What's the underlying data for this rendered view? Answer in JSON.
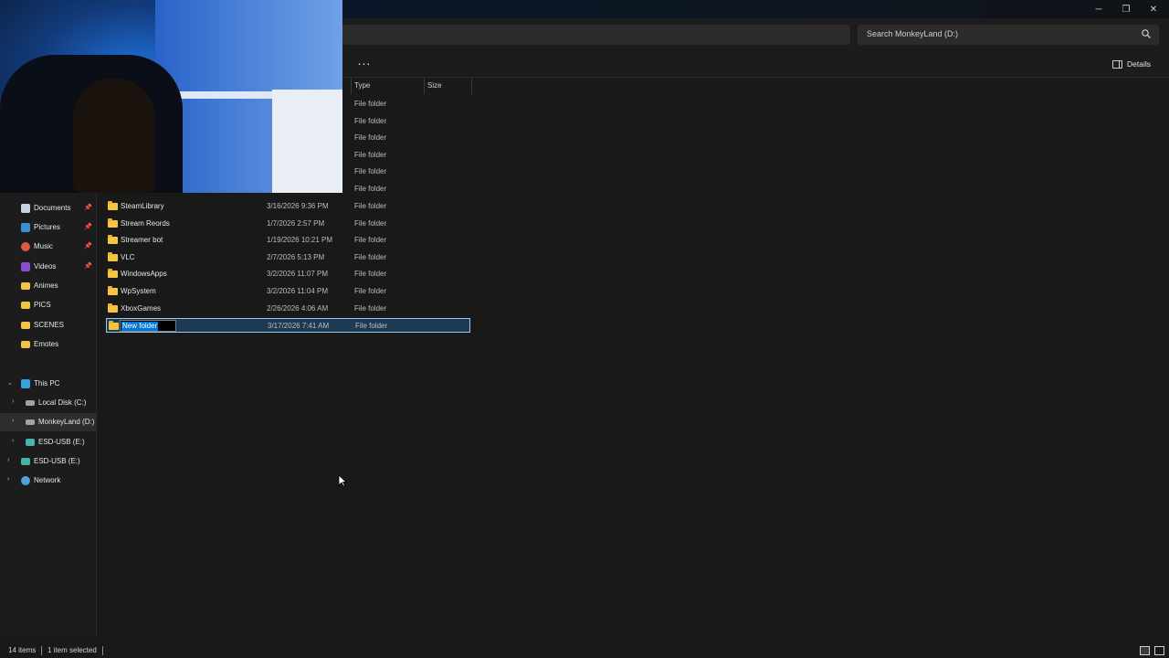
{
  "window": {
    "minimize_glyph": "─",
    "maximize_glyph": "❐",
    "close_glyph": "✕"
  },
  "search": {
    "placeholder": "Search MonkeyLand (D:)"
  },
  "toolbar": {
    "more_label": "...",
    "details_label": "Details"
  },
  "columns": {
    "type": "Type",
    "size": "Size"
  },
  "files": [
    {
      "name": "",
      "date": "",
      "type": "File folder"
    },
    {
      "name": "",
      "date": "",
      "type": "File folder"
    },
    {
      "name": "",
      "date": "",
      "type": "File folder"
    },
    {
      "name": "",
      "date": "",
      "type": "File folder"
    },
    {
      "name": "",
      "date": "",
      "type": "File folder"
    },
    {
      "name": "",
      "date": "",
      "type": "File folder"
    },
    {
      "name": "SteamLibrary",
      "date": "3/16/2026 9:36 PM",
      "type": "File folder"
    },
    {
      "name": "Stream Reords",
      "date": "1/7/2026 2:57 PM",
      "type": "File folder"
    },
    {
      "name": "Streamer bot",
      "date": "1/19/2026 10:21 PM",
      "type": "File folder"
    },
    {
      "name": "VLC",
      "date": "2/7/2026 5:13 PM",
      "type": "File folder"
    },
    {
      "name": "WindowsApps",
      "date": "3/2/2026 11:07 PM",
      "type": "File folder"
    },
    {
      "name": "WpSystem",
      "date": "3/2/2026 11:04 PM",
      "type": "File folder"
    },
    {
      "name": "XboxGames",
      "date": "2/26/2026 4:06 AM",
      "type": "File folder"
    },
    {
      "name": "New folder",
      "date": "3/17/2026 7:41 AM",
      "type": "File folder",
      "selected": true,
      "renaming": true
    }
  ],
  "sidebar": {
    "quick_access": [
      {
        "label": "Documents",
        "icon": "documents-icon",
        "pinned": true
      },
      {
        "label": "Pictures",
        "icon": "pictures-icon",
        "pinned": true
      },
      {
        "label": "Music",
        "icon": "music-icon",
        "pinned": true
      },
      {
        "label": "Videos",
        "icon": "videos-icon",
        "pinned": true
      },
      {
        "label": "Animes",
        "icon": "folder-icon"
      },
      {
        "label": "PICS",
        "icon": "folder-icon"
      },
      {
        "label": "SCENES",
        "icon": "folder-icon"
      },
      {
        "label": "Emotes",
        "icon": "folder-icon"
      }
    ],
    "tree": [
      {
        "label": "This PC",
        "icon": "pc-icon",
        "expanded": true
      },
      {
        "label": "Local Disk (C:)",
        "icon": "disk-icon"
      },
      {
        "label": "MonkeyLand (D:)",
        "icon": "disk-icon",
        "active": true
      },
      {
        "label": "ESD-USB (E:)",
        "icon": "usb-icon"
      },
      {
        "label": "ESD-USB (E:)",
        "icon": "usb-icon"
      },
      {
        "label": "Network",
        "icon": "network-icon"
      }
    ],
    "pin_glyph": "📌",
    "chevron_right": "›",
    "chevron_down": "⌄"
  },
  "status": {
    "item_count": "14 items",
    "selection": "1 item selected"
  }
}
